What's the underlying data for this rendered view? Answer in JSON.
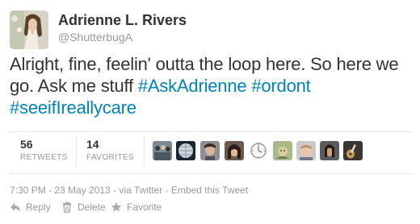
{
  "user": {
    "full_name": "Adrienne L. Rivers",
    "screen_name": "@ShutterbugA"
  },
  "tweet": {
    "text_plain_1": "Alright, fine, feelin' outta the loop here. So here we go. Ask me stuff ",
    "hashtags": [
      "#AskAdrienne",
      "#ordont",
      "#seeifIreallycare"
    ]
  },
  "stats": {
    "retweets_count": "56",
    "retweets_label": "RETWEETS",
    "favorites_count": "14",
    "favorites_label": "FAVORITES"
  },
  "favoriters": [
    {
      "icon": "avatar-crowd"
    },
    {
      "icon": "avatar-globe"
    },
    {
      "icon": "avatar-face-1"
    },
    {
      "icon": "avatar-face-2"
    },
    {
      "icon": "avatar-clock"
    },
    {
      "icon": "avatar-green"
    },
    {
      "icon": "avatar-face-3"
    },
    {
      "icon": "avatar-face-4"
    },
    {
      "icon": "avatar-guitar"
    }
  ],
  "meta": {
    "timestamp": "7:30 PM - 23 May 2013",
    "via": "via Twitter",
    "embed": "Embed this Tweet"
  },
  "actions": {
    "reply": "Reply",
    "delete": "Delete",
    "favorite": "Favorite"
  },
  "colors": {
    "link": "#0084b4",
    "text": "#333333",
    "muted": "#999999"
  }
}
